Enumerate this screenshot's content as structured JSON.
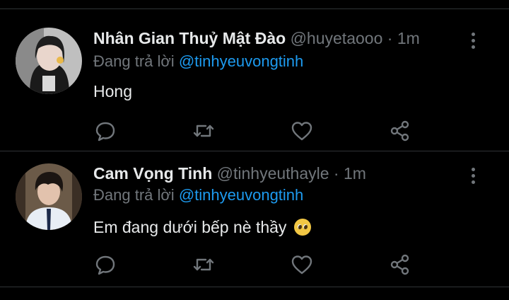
{
  "tweets": [
    {
      "name": "Nhân Gian Thuỷ Mật Đào",
      "handle": "@huyetaooo",
      "separator": "·",
      "time": "1m",
      "reply_prefix": "Đang trả lời",
      "reply_to": "@tinhyeuvongtinh",
      "text": "Hong",
      "avatar_icon": "profile-photo-girl"
    },
    {
      "name": "Cam Vọng Tinh",
      "handle": "@tinhyeuthayle",
      "separator": "·",
      "time": "1m",
      "reply_prefix": "Đang trả lời",
      "reply_to": "@tinhyeuvongtinh",
      "text": "Em đang dưới bếp nè thầy",
      "emoji": "pleading-face-emoji",
      "avatar_icon": "profile-photo-boy"
    }
  ],
  "actions": [
    "reply-icon",
    "retweet-icon",
    "like-icon",
    "share-icon"
  ],
  "colors": {
    "background": "#000000",
    "text": "#e7e9ea",
    "muted": "#71767b",
    "link": "#1d9bf0",
    "divider": "#2f3336"
  }
}
